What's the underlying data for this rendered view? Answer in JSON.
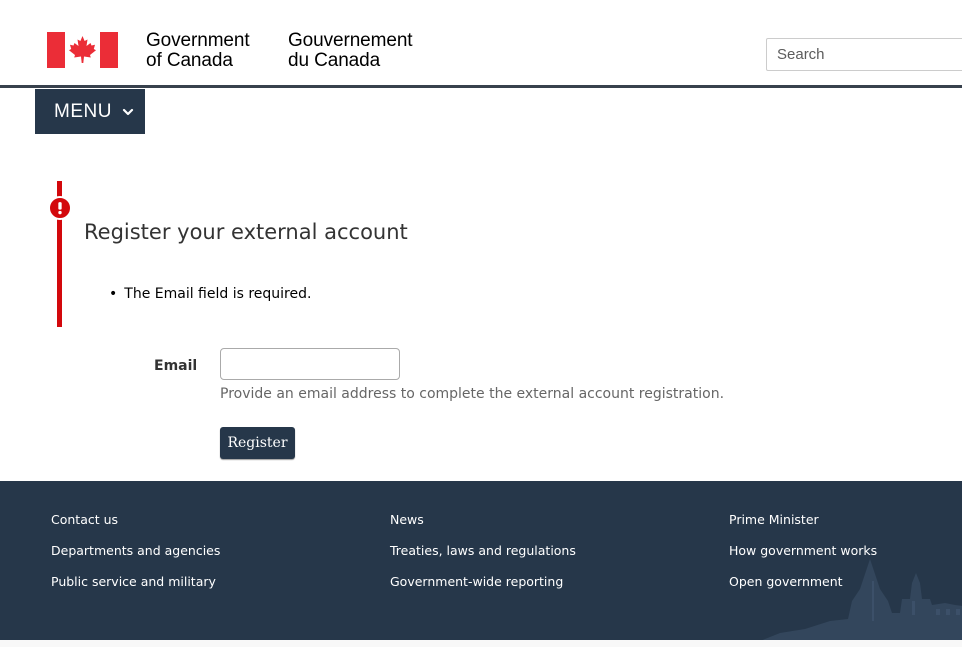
{
  "header": {
    "wordmark_en_line1": "Government",
    "wordmark_en_line2": "of Canada",
    "wordmark_fr_line1": "Gouvernement",
    "wordmark_fr_line2": "du Canada",
    "search_placeholder": "Search",
    "flag_color": "#eb2d37"
  },
  "menu": {
    "label": "MENU"
  },
  "error": {
    "title": "Register your external account",
    "items": [
      "The Email field is required."
    ],
    "color": "#d3080c"
  },
  "form": {
    "email_label": "Email",
    "email_value": "",
    "hint": "Provide an email address to complete the external account registration.",
    "register_label": "Register"
  },
  "footer": {
    "background": "#26374a",
    "columns": [
      [
        "Contact us",
        "Departments and agencies",
        "Public service and military"
      ],
      [
        "News",
        "Treaties, laws and regulations",
        "Government-wide reporting"
      ],
      [
        "Prime Minister",
        "How government works",
        "Open government"
      ]
    ]
  }
}
